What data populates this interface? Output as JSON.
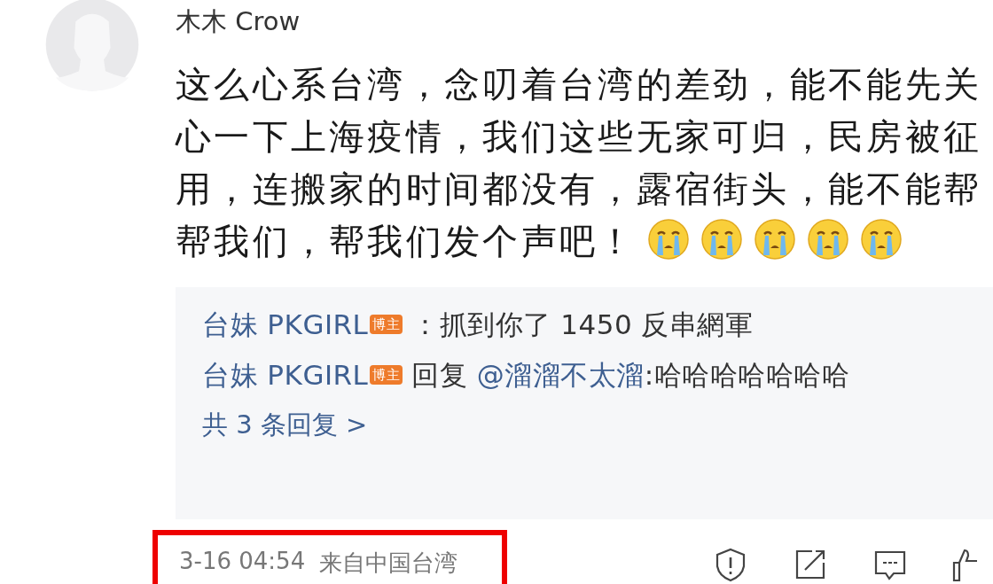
{
  "comment": {
    "author": "木木 Crow",
    "lines": [
      "这么心系台湾，念叨着台湾的差劲，能不能先关",
      "心一下上海疫情，我们这些无家可归，民房被征",
      "用，连搬家的时间都没有，露宿街头，能不能帮",
      "帮我们，帮我们发个声吧！"
    ],
    "emoji": [
      {
        "kind": "crying"
      },
      {
        "kind": "crying"
      },
      {
        "kind": "crying"
      },
      {
        "kind": "crying"
      },
      {
        "kind": "crying"
      }
    ]
  },
  "replies": [
    {
      "author": "台妹 PKGIRL",
      "badge": "博主",
      "text": "：抓到你了 1450 反串網軍"
    },
    {
      "author": "台妹 PKGIRL",
      "badge": "博主",
      "text": "回复 ",
      "mention": "@溜溜不太溜",
      "after": ":哈哈哈哈哈哈哈"
    }
  ],
  "more_replies": "共 3 条回复 >",
  "footer": {
    "time": "3-16 04:54",
    "source": "来自中国台湾",
    "highlighted": true
  }
}
